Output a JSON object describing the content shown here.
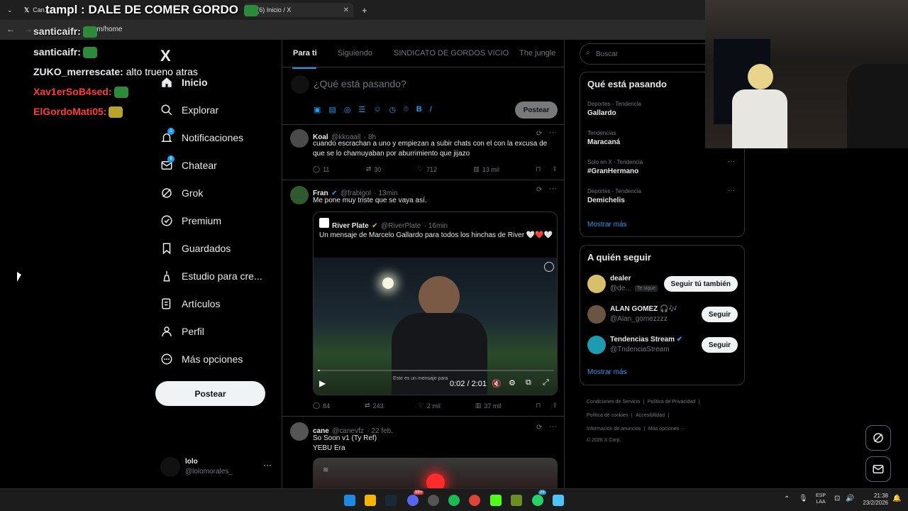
{
  "browser": {
    "tabs": [
      {
        "title": "Can..."
      },
      {
        "title": "(6) Inicio / X"
      }
    ],
    "url": "x.com/home",
    "new_tab": "+"
  },
  "overlay": {
    "title": "tampl : DALE DE COMER GORDO",
    "chat": [
      {
        "user": "santicaifr:",
        "msg": ""
      },
      {
        "user": "santicaifr:",
        "msg": ""
      },
      {
        "user": "ZUKO_merrescate:",
        "msg": "alto trueno atras"
      },
      {
        "user": "Xav1erSoB4sed:",
        "msg": ""
      },
      {
        "user": "ElGordoMati05:",
        "msg": ""
      }
    ]
  },
  "sidebar": {
    "logo": "X",
    "items": [
      {
        "label": "Inicio",
        "icon": "home-icon"
      },
      {
        "label": "Explorar",
        "icon": "search-icon"
      },
      {
        "label": "Notificaciones",
        "icon": "bell-icon",
        "badge": "1"
      },
      {
        "label": "Chatear",
        "icon": "mail-icon",
        "badge": "6"
      },
      {
        "label": "Grok",
        "icon": "grok-icon"
      },
      {
        "label": "Premium",
        "icon": "premium-icon"
      },
      {
        "label": "Guardados",
        "icon": "bookmark-icon"
      },
      {
        "label": "Estudio para cre...",
        "icon": "studio-icon"
      },
      {
        "label": "Artículos",
        "icon": "article-icon"
      },
      {
        "label": "Perfil",
        "icon": "person-icon"
      },
      {
        "label": "Más opciones",
        "icon": "more-icon"
      }
    ],
    "post_button": "Postear",
    "account": {
      "name": "lolo",
      "handle": "@lolomorales_",
      "more": "···"
    }
  },
  "feed": {
    "tabs": [
      "Para ti",
      "Siguiendo",
      "SINDICATO DE GORDOS VICIO",
      "The jungle"
    ],
    "composer": {
      "placeholder": "¿Qué está pasando?",
      "button": "Postear"
    },
    "tweets": [
      {
        "name": "Koal",
        "handle": "@kkoaall",
        "time": "· 8h",
        "text": "cuando escrachan a uno y empiezan a subir chats con el con la excusa de que se lo chamuyaban por aburrimiento que jijazo",
        "replies": "11",
        "retweets": "30",
        "likes": "712",
        "views": "13 mil"
      },
      {
        "name": "Fran",
        "handle": "@frabigol",
        "time": "· 13min",
        "text": "Me pone muy triste que se vaya así.",
        "quote": {
          "name": "River Plate",
          "handle": "@RiverPlate",
          "time": "· 16min",
          "text": "Un mensaje de Marcelo Gallardo para todos los hinchas de River 🤍❤️🤍",
          "video_time": "0:02 / 2:01",
          "video_caption": "Este es un mensaje para"
        },
        "replies": "84",
        "retweets": "243",
        "likes": "2 mil",
        "views": "37 mil"
      },
      {
        "name": "cane",
        "handle": "@canevfz",
        "time": "· 22 feb.",
        "text": "So Soon v1 (Ty Ref)",
        "text2": "YEBU Era"
      }
    ]
  },
  "right": {
    "search_placeholder": "Buscar",
    "trends_title": "Qué está pasando",
    "trends": [
      {
        "cat": "Deportes · Tendencia",
        "name": "Gallardo"
      },
      {
        "cat": "Tendencias",
        "name": "Maracaná"
      },
      {
        "cat": "Solo en X · Tendencia",
        "name": "#GranHermano"
      },
      {
        "cat": "Deportes · Tendencia",
        "name": "Demichelis"
      }
    ],
    "show_more": "Mostrar más",
    "follow_title": "A quién seguir",
    "follow": [
      {
        "name": "dealer",
        "handle": "@de...",
        "tag": "Te sigue",
        "button": "Seguir tú también"
      },
      {
        "name": "ALAN GOMEZ 🎧🎶",
        "handle": "@Alan_gomezzzz",
        "button": "Seguir"
      },
      {
        "name": "Tendencias Stream",
        "handle": "@TndenciaStream",
        "button": "Seguir"
      }
    ],
    "show_more2": "Mostrar más",
    "footer": [
      "Condiciones de Servicio",
      "Política de Privacidad",
      "Política de cookies",
      "Accesibilidad",
      "Información de anuncios",
      "Más opciones ···",
      "© 2026 X Corp."
    ]
  },
  "taskbar": {
    "lang": "ESP",
    "lang2": "LAA",
    "time": "21:38",
    "date": "23/2/2026",
    "badges": {
      "discord": "99+",
      "whatsapp": "25"
    }
  },
  "colors": {
    "accent": "#1d9bf0",
    "bg": "#000000",
    "border": "#2f3336",
    "muted": "#71767b"
  }
}
